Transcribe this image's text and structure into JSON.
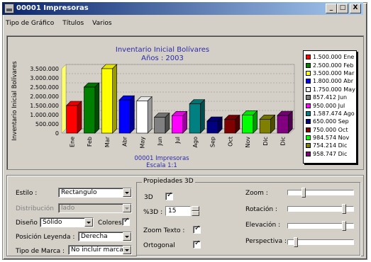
{
  "window": {
    "title": "00001 Impresoras",
    "btn_min": "_",
    "btn_max": "□",
    "btn_close": "X"
  },
  "menu": [
    "Tipo de Gráfico",
    "Títulos",
    "Varios"
  ],
  "chart_data": {
    "type": "bar",
    "title": "Inventario Inicial  Bolívares",
    "subtitle": "Años : 2003",
    "footer1": "00001 Impresoras",
    "footer2": "Escala 1:1",
    "ylabel": "Inventario Inicial  Bolívares",
    "ylim": [
      0,
      3500000
    ],
    "yticks": [
      "3.500.000",
      "3.000.000",
      "2.500.000",
      "2.000.000",
      "1.500.000",
      "1.000.000",
      "500.000",
      "0"
    ],
    "categories": [
      "Ene",
      "Feb",
      "Mar",
      "Abr",
      "May",
      "Jun",
      "Jul",
      "Ago",
      "Sep",
      "Oct",
      "Nov",
      "Dic",
      "Dic"
    ],
    "values": [
      1500000,
      2500000,
      3500000,
      1800000,
      1750000,
      857412,
      950000,
      1587474,
      650000,
      750000,
      984574,
      754214,
      958747
    ],
    "colors": [
      "#ff0000",
      "#008000",
      "#ffff00",
      "#0000ff",
      "#ffffff",
      "#808080",
      "#ff00ff",
      "#008080",
      "#000080",
      "#800000",
      "#00ff00",
      "#808000",
      "#800080"
    ],
    "legend": [
      "1.500.000 Ene",
      "2.500.000 Feb",
      "3.500.000 Mar",
      "1.800.000 Abr",
      "1.750.000 May",
      "857.412 Jun",
      "950.000 Jul",
      "1.587.474 Ago",
      "650.000 Sep",
      "750.000 Oct",
      "984.574 Nov",
      "754.214 Dic",
      "958.747 Dic"
    ],
    "legend_position": "right",
    "grid": true
  },
  "settings": {
    "estilo_label": "Estilo :",
    "estilo_value": "Rectangulo",
    "distribucion_label": "Distribución",
    "distribucion_value": "lado",
    "diseno_label": "Diseño :",
    "diseno_value": "Sólido",
    "colores_label": "Colores",
    "posicion_label": "Posición Leyenda :",
    "posicion_value": "Derecha",
    "marca_label": "Tipo de Marca :",
    "marca_value": "No incluir marcas"
  },
  "props3d": {
    "group_label": "Propiedades 3D",
    "label_3d": "3D",
    "pct3d_label": "%3D :",
    "pct3d_value": "15",
    "zoomtext_label": "Zoom Texto :",
    "ortogonal_label": "Ortogonal",
    "zoom_label": "Zoom :",
    "rotacion_label": "Rotación :",
    "elevacion_label": "Elevación :",
    "perspectiva_label": "Perspectiva :"
  }
}
